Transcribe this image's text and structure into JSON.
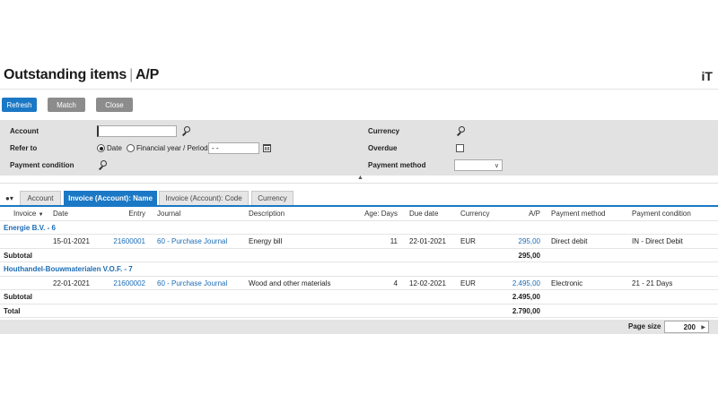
{
  "page": {
    "title": "Outstanding items",
    "title_separator": "|",
    "subtitle": "A/P",
    "brand": "iT"
  },
  "toolbar": {
    "refresh_label": "Refresh",
    "match_label": "Match",
    "close_label": "Close"
  },
  "filters": {
    "account_label": "Account",
    "account_value": "",
    "refer_to_label": "Refer to",
    "refer_to_options": [
      "Date",
      "Financial year / Period"
    ],
    "refer_to_selected": "Date",
    "period_value": "- -",
    "payment_condition_label": "Payment condition",
    "currency_label": "Currency",
    "overdue_label": "Overdue",
    "overdue_checked": false,
    "payment_method_label": "Payment method",
    "payment_method_value": ""
  },
  "tabs": [
    {
      "label": "Account",
      "active": false
    },
    {
      "label": "Invoice (Account): Name",
      "active": true
    },
    {
      "label": "Invoice (Account): Code",
      "active": false
    },
    {
      "label": "Currency",
      "active": false
    }
  ],
  "table": {
    "columns": [
      "Invoice",
      "Date",
      "Entry",
      "Journal",
      "Description",
      "Age: Days",
      "Due date",
      "Currency",
      "A/P",
      "Payment method",
      "Payment condition"
    ],
    "groups": [
      {
        "name": "Energie B.V. - 6",
        "rows": [
          {
            "invoice": "",
            "date": "15-01-2021",
            "entry": "21600001",
            "journal": "60 - Purchase Journal",
            "description": "Energy bill",
            "age": "11",
            "due": "22-01-2021",
            "currency": "EUR",
            "ap": "295,00",
            "method": "Direct debit",
            "condition": "IN - Direct Debit"
          }
        ],
        "subtotal_label": "Subtotal",
        "subtotal": "295,00"
      },
      {
        "name": "Houthandel-Bouwmaterialen V.O.F. - 7",
        "rows": [
          {
            "invoice": "",
            "date": "22-01-2021",
            "entry": "21600002",
            "journal": "60 - Purchase Journal",
            "description": "Wood and other materials",
            "age": "4",
            "due": "12-02-2021",
            "currency": "EUR",
            "ap": "2.495,00",
            "method": "Electronic",
            "condition": "21 - 21 Days"
          }
        ],
        "subtotal_label": "Subtotal",
        "subtotal": "2.495,00"
      }
    ],
    "total_label": "Total",
    "total": "2.790,00"
  },
  "pager": {
    "page_size_label": "Page size",
    "page_size": "200"
  },
  "colors": {
    "accent": "#1b78c5",
    "link": "#1b6cb5",
    "button_grey": "#8c8c8c",
    "panel_grey": "#e2e2e2"
  },
  "icons": [
    "search-icon",
    "calendar-icon",
    "chevron-down-icon",
    "collapse-caret-icon",
    "column-chooser-icon",
    "sort-desc-icon"
  ]
}
